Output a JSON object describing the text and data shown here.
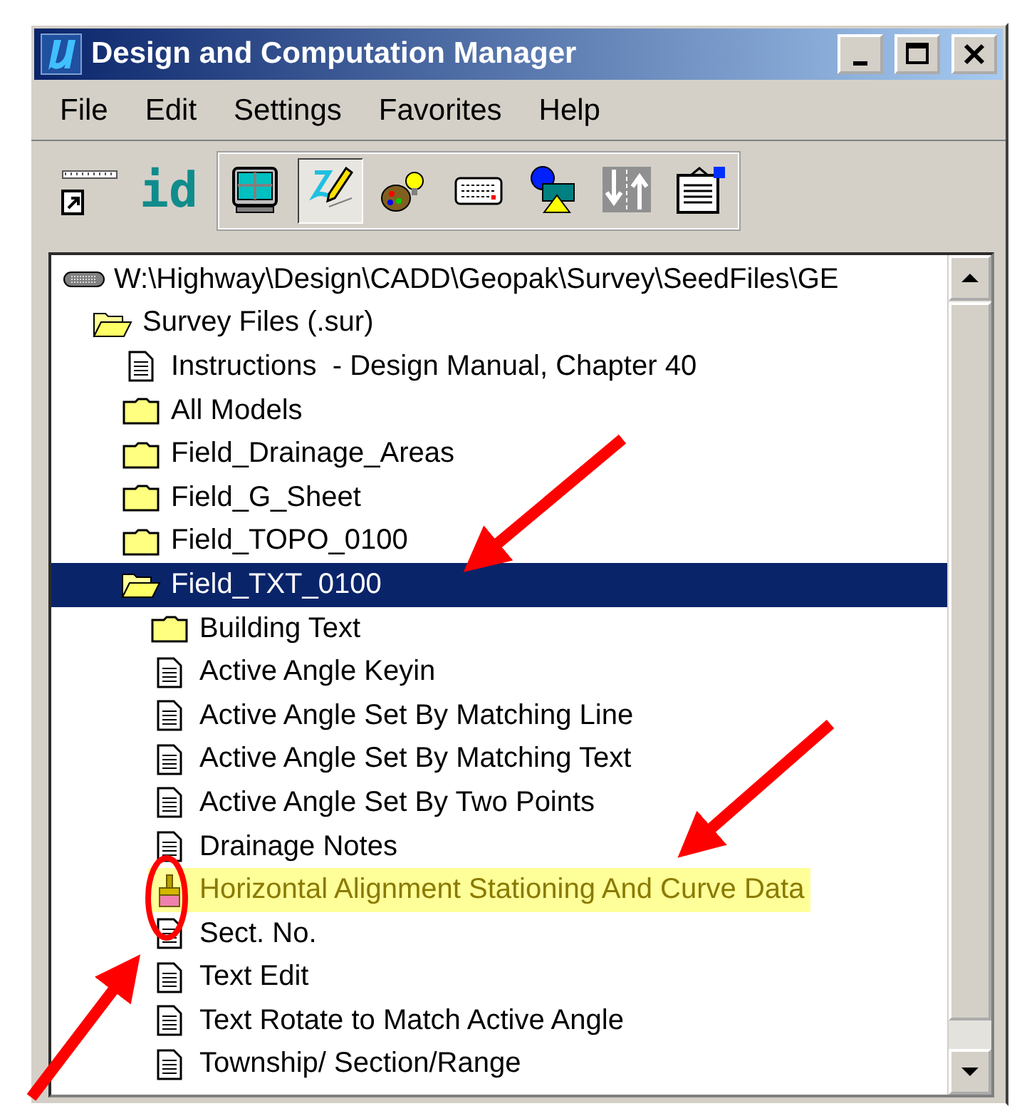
{
  "window": {
    "title": "Design and Computation Manager"
  },
  "menu": [
    {
      "label": "File"
    },
    {
      "label": "Edit"
    },
    {
      "label": "Settings"
    },
    {
      "label": "Favorites"
    },
    {
      "label": "Help"
    }
  ],
  "toolbar": {
    "loose": [
      {
        "kind": "ruler"
      },
      {
        "kind": "id",
        "label": "id"
      }
    ],
    "group": [
      {
        "kind": "grid",
        "pressed": false
      },
      {
        "kind": "pen",
        "pressed": true
      },
      {
        "kind": "palette",
        "pressed": false
      },
      {
        "kind": "keypad",
        "pressed": false
      },
      {
        "kind": "shapes",
        "pressed": false
      },
      {
        "kind": "arrows",
        "pressed": false
      },
      {
        "kind": "clipboard",
        "pressed": false
      }
    ]
  },
  "tree": {
    "root": {
      "label": "W:\\Highway\\Design\\CADD\\Geopak\\Survey\\SeedFiles\\GE",
      "kind": "drive",
      "selected": false,
      "highlighted": false,
      "children": [
        {
          "label": "Survey Files (.sur)",
          "kind": "folder",
          "expanded": true,
          "selected": false,
          "highlighted": false,
          "children": [
            {
              "label": "Instructions  - Design Manual, Chapter 40",
              "kind": "document",
              "selected": false,
              "highlighted": false
            },
            {
              "label": "All Models",
              "kind": "folder",
              "expanded": false,
              "selected": false,
              "highlighted": false
            },
            {
              "label": "Field_Drainage_Areas",
              "kind": "folder",
              "expanded": false,
              "selected": false,
              "highlighted": false
            },
            {
              "label": "Field_G_Sheet",
              "kind": "folder",
              "expanded": false,
              "selected": false,
              "highlighted": false
            },
            {
              "label": "Field_TOPO_0100",
              "kind": "folder",
              "expanded": false,
              "selected": false,
              "highlighted": false
            },
            {
              "label": "Field_TXT_0100",
              "kind": "folder",
              "expanded": true,
              "selected": true,
              "highlighted": false,
              "children": [
                {
                  "label": "Building Text",
                  "kind": "folder",
                  "expanded": false,
                  "selected": false,
                  "highlighted": false
                },
                {
                  "label": "Active Angle Keyin",
                  "kind": "document",
                  "selected": false,
                  "highlighted": false
                },
                {
                  "label": "Active Angle Set By Matching Line",
                  "kind": "document",
                  "selected": false,
                  "highlighted": false
                },
                {
                  "label": "Active Angle Set By Matching Text",
                  "kind": "document",
                  "selected": false,
                  "highlighted": false
                },
                {
                  "label": "Active Angle Set By Two Points",
                  "kind": "document",
                  "selected": false,
                  "highlighted": false
                },
                {
                  "label": "Drainage Notes",
                  "kind": "document",
                  "selected": false,
                  "highlighted": false
                },
                {
                  "label": "Horizontal Alignment Stationing And Curve Data",
                  "kind": "brush",
                  "selected": false,
                  "highlighted": true
                },
                {
                  "label": "Sect. No.",
                  "kind": "document",
                  "selected": false,
                  "highlighted": false
                },
                {
                  "label": "Text Edit",
                  "kind": "document",
                  "selected": false,
                  "highlighted": false
                },
                {
                  "label": "Text Rotate to Match Active Angle",
                  "kind": "document",
                  "selected": false,
                  "highlighted": false
                },
                {
                  "label": "Township/ Section/Range",
                  "kind": "document",
                  "selected": false,
                  "highlighted": false
                }
              ]
            }
          ]
        }
      ]
    }
  }
}
